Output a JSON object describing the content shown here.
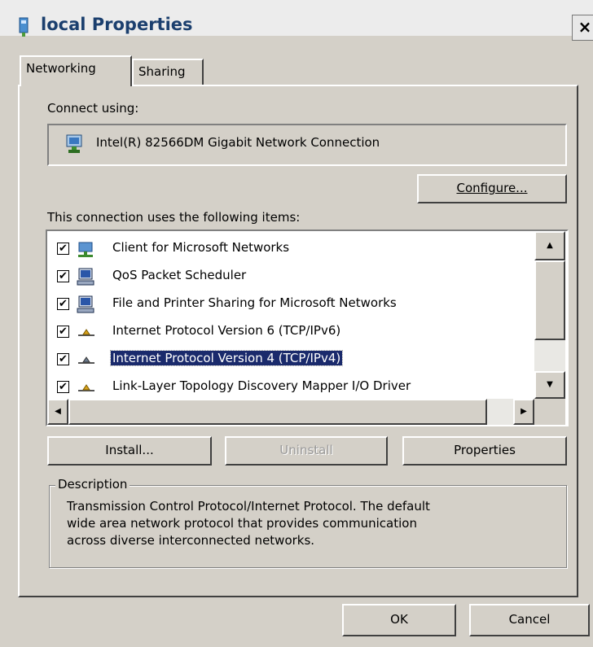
{
  "window": {
    "title": "local Properties",
    "close_glyph": "×"
  },
  "tabs": [
    {
      "label": "Networking"
    },
    {
      "label": "Sharing"
    }
  ],
  "connect_using": {
    "label": "Connect using:",
    "adapter": "Intel(R) 82566DM Gigabit Network Connection",
    "configure_button": "Configure..."
  },
  "items": {
    "label": "This connection uses the following items:",
    "rows": [
      {
        "label": "Client for Microsoft Networks",
        "checked": true,
        "icon": "network-client-icon"
      },
      {
        "label": "QoS Packet Scheduler",
        "checked": true,
        "icon": "computer-service-icon"
      },
      {
        "label": "File and Printer Sharing for Microsoft Networks",
        "checked": true,
        "icon": "computer-service-icon"
      },
      {
        "label": "Internet Protocol Version 6 (TCP/IPv6)",
        "checked": true,
        "icon": "protocol-icon"
      },
      {
        "label": "Internet Protocol Version 4 (TCP/IPv4)",
        "checked": true,
        "icon": "protocol-icon",
        "selected": true
      },
      {
        "label": "Link-Layer Topology Discovery Mapper I/O Driver",
        "checked": true,
        "icon": "protocol-icon"
      }
    ]
  },
  "buttons": {
    "install": "Install...",
    "uninstall": "Uninstall",
    "properties": "Properties",
    "ok": "OK",
    "cancel": "Cancel"
  },
  "description": {
    "legend": "Description",
    "lines": [
      "Transmission Control Protocol/Internet Protocol. The default",
      "wide area network protocol that provides communication",
      "across diverse interconnected networks."
    ]
  },
  "colors": {
    "face": "#d4d0c8",
    "selection": "#1a2a6c",
    "title_text": "#1b3f6e"
  }
}
